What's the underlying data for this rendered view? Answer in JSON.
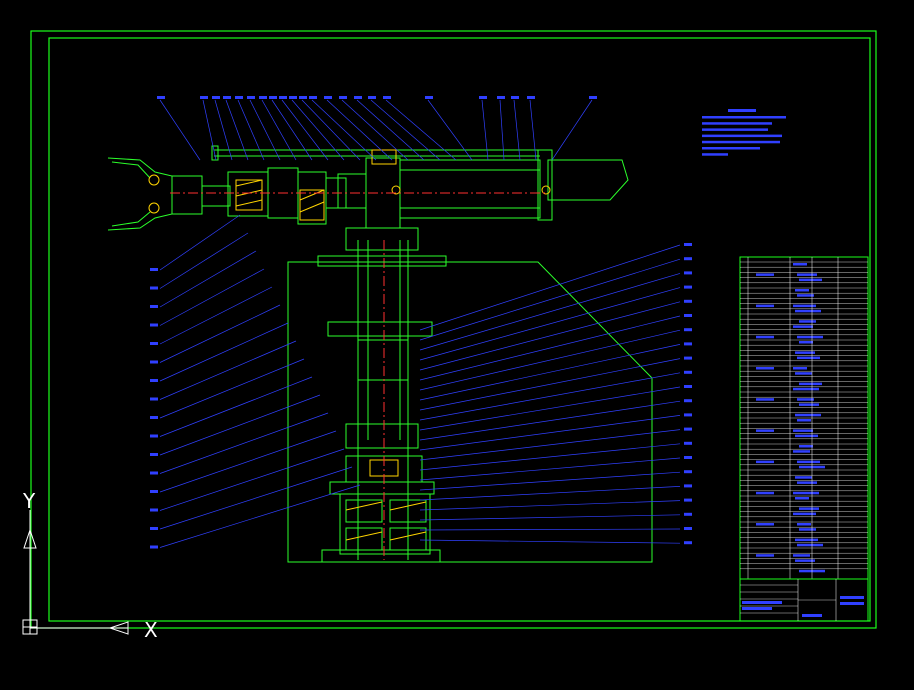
{
  "colors": {
    "background": "#000000",
    "frame": "#1aff1a",
    "part_outline": "#2bff2b",
    "hatch": "#ffd400",
    "leader": "#3040ff",
    "label": "#4a5cff",
    "centerline": "#ff3030",
    "axis": "#ffffff"
  },
  "ucs_icon": {
    "y_label": "Y",
    "x_label": "X"
  },
  "drawing": {
    "assembly_type": "manipulator-arm-section",
    "icons": [
      "gripper-jaw-icon",
      "column-cylinder-icon",
      "base-gear-icon"
    ]
  }
}
